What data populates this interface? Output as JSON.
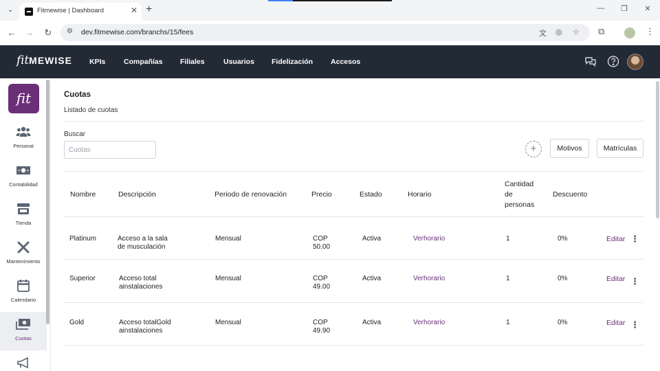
{
  "browser": {
    "tab_title": "Fitmewise | Dashboard",
    "url": "dev.fitmewise.com/branchs/15/fees"
  },
  "header": {
    "logo_script": "fit",
    "logo_text": "MEWISE",
    "nav": [
      {
        "label": "KPIs"
      },
      {
        "label": "Compañías"
      },
      {
        "label": "Filiales"
      },
      {
        "label": "Usuarios"
      },
      {
        "label": "Fidelización"
      },
      {
        "label": "Accesos"
      }
    ]
  },
  "sidebar": {
    "logo_text": "fit",
    "items": [
      {
        "label": "Personal",
        "icon": "people-icon"
      },
      {
        "label": "Contabilidad",
        "icon": "money-icon"
      },
      {
        "label": "Tienda",
        "icon": "store-icon"
      },
      {
        "label": "Mantenimiento",
        "icon": "tools-icon"
      },
      {
        "label": "Calendario",
        "icon": "calendar-icon"
      },
      {
        "label": "Cuotas",
        "icon": "cash-icon",
        "active": true
      },
      {
        "label": "",
        "icon": "megaphone-icon"
      }
    ]
  },
  "page": {
    "title": "Cuotas",
    "subtitle": "Listado de cuotas",
    "search_label": "Buscar",
    "search_placeholder": "Cuotas",
    "add_icon": "+",
    "btn_motivos": "Motivos",
    "btn_matriculas": "Matrículas"
  },
  "table": {
    "headers": {
      "nombre": "Nombre",
      "descripcion": "Descripción",
      "periodo": "Periodo de renovación",
      "precio": "Precio",
      "estado": "Estado",
      "horario": "Horario",
      "cantidad_1": "Cantidad",
      "cantidad_2": "de",
      "cantidad_3": "personas",
      "descuento": "Descuento"
    },
    "rows": [
      {
        "nombre": "Platinum",
        "desc_1": "Acceso a la sala",
        "desc_2": "de musculación",
        "periodo": "Mensual",
        "precio_1": "COP",
        "precio_2": "50.00",
        "estado": "Activa",
        "horario": "Verhorario",
        "cantidad": "1",
        "descuento": "0%",
        "edit": "Editar"
      },
      {
        "nombre": "Superior",
        "desc_1": "Acceso total",
        "desc_2": "ainstalaciones",
        "periodo": "Mensual",
        "precio_1": "COP",
        "precio_2": "49.00",
        "estado": "Activa",
        "horario": "Verhorario",
        "cantidad": "1",
        "descuento": "0%",
        "edit": "Editar"
      },
      {
        "nombre": "Gold",
        "desc_1": "Acceso totalGold",
        "desc_2": "ainstalaciones",
        "periodo": "Mensual",
        "precio_1": "COP",
        "precio_2": "49.90",
        "estado": "Activa",
        "horario": "Verhorario",
        "cantidad": "1",
        "descuento": "0%",
        "edit": "Editar"
      }
    ]
  },
  "colors": {
    "header_bg": "#222a36",
    "accent": "#6b2f7a"
  }
}
